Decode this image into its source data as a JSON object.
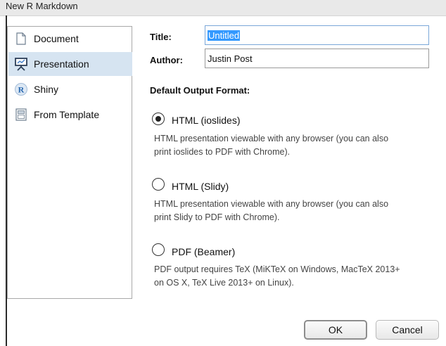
{
  "window": {
    "title": "New R Markdown"
  },
  "sidebar": {
    "items": [
      {
        "label": "Document",
        "icon": "document-icon",
        "selected": false
      },
      {
        "label": "Presentation",
        "icon": "presentation-icon",
        "selected": true
      },
      {
        "label": "Shiny",
        "icon": "shiny-icon",
        "selected": false
      },
      {
        "label": "From Template",
        "icon": "template-icon",
        "selected": false
      }
    ]
  },
  "form": {
    "title_label": "Title:",
    "title_value": "Untitled",
    "author_label": "Author:",
    "author_value": "Justin Post"
  },
  "output_format": {
    "heading": "Default Output Format:",
    "selected": "HTML (ioslides)",
    "options": [
      {
        "label": "HTML (ioslides)",
        "checked": true,
        "desc_line1": "HTML presentation viewable with any browser (you can also",
        "desc_line2": "print ioslides to PDF with Chrome)."
      },
      {
        "label": "HTML (Slidy)",
        "checked": false,
        "desc_line1": "HTML presentation viewable with any browser (you can also",
        "desc_line2": "print Slidy to PDF with Chrome)."
      },
      {
        "label": "PDF (Beamer)",
        "checked": false,
        "desc_line1": "PDF output requires TeX (MiKTeX on Windows, MacTeX 2013+",
        "desc_line2": "on OS X, TeX Live 2013+ on Linux)."
      }
    ]
  },
  "buttons": {
    "ok": "OK",
    "cancel": "Cancel"
  },
  "colors": {
    "selection_bg": "#d6e4f1",
    "text_selection": "#3399ff"
  }
}
